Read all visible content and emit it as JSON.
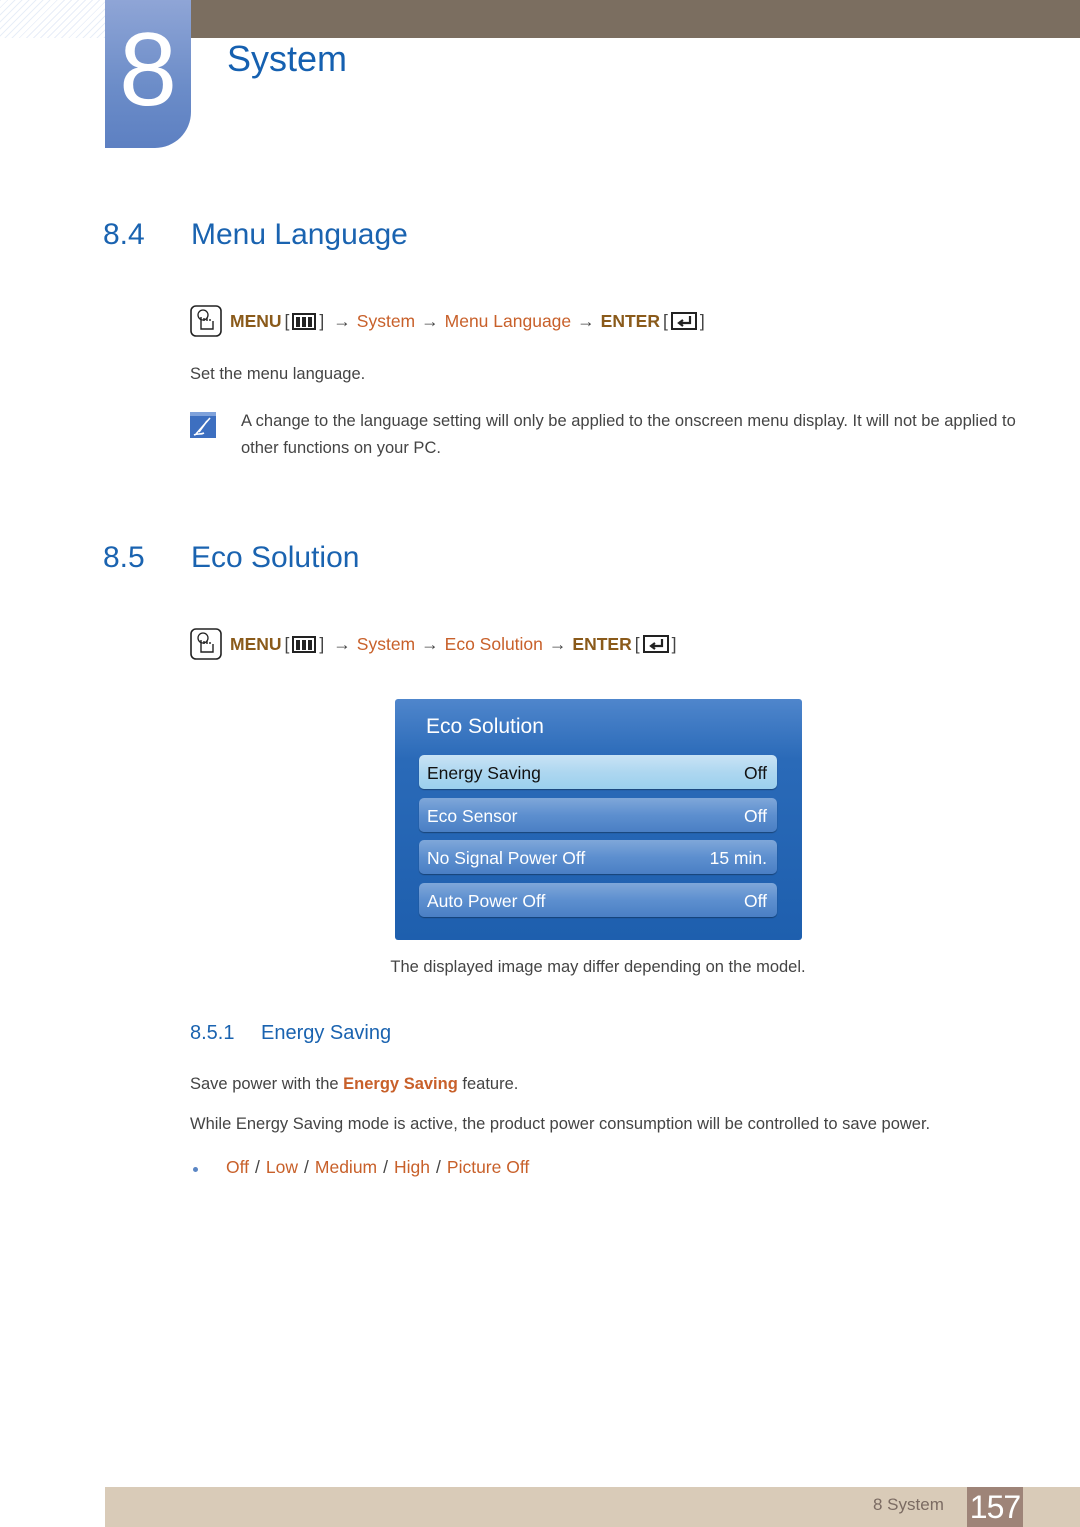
{
  "chapter": {
    "number": "8",
    "title": "System"
  },
  "sections": {
    "menu_language": {
      "number": "8.4",
      "title": "Menu Language",
      "path": {
        "menu": "MENU",
        "steps": [
          "System",
          "Menu Language"
        ],
        "enter": "ENTER",
        "arrow": "→",
        "open_bracket": "[",
        "close_bracket": "]"
      },
      "description": "Set the menu language.",
      "note": "A change to the language setting will only be applied to the onscreen menu display. It will not be applied to other functions on your PC."
    },
    "eco_solution": {
      "number": "8.5",
      "title": "Eco Solution",
      "path": {
        "menu": "MENU",
        "steps": [
          "System",
          "Eco Solution"
        ],
        "enter": "ENTER",
        "arrow": "→",
        "open_bracket": "[",
        "close_bracket": "]"
      },
      "osd": {
        "title": "Eco Solution",
        "items": [
          {
            "label": "Energy Saving",
            "value": "Off",
            "selected": true
          },
          {
            "label": "Eco Sensor",
            "value": "Off",
            "selected": false
          },
          {
            "label": "No Signal Power Off",
            "value": "15 min.",
            "selected": false
          },
          {
            "label": "Auto Power Off",
            "value": "Off",
            "selected": false
          }
        ]
      },
      "caption": "The displayed image may differ depending on the model."
    },
    "energy_saving": {
      "number": "8.5.1",
      "title": "Energy Saving",
      "intro_prefix": "Save power with the ",
      "intro_highlight": "Energy Saving",
      "intro_suffix": " feature.",
      "description": "While Energy Saving mode is active, the product power consumption will be controlled to save power.",
      "options": [
        "Off",
        "Low",
        "Medium",
        "High",
        "Picture Off"
      ],
      "option_separator": "/"
    }
  },
  "footer": {
    "chapter_label": "8 System",
    "page_number": "157"
  },
  "icons": {
    "hand": "hand-pointer-icon",
    "menu_key": "menu-button-icon",
    "enter_key": "enter-button-icon",
    "note": "note-pencil-icon"
  },
  "colors": {
    "heading_blue": "#1a63b0",
    "highlight_orange": "#c8602a",
    "menu_brown": "#8a5a1a",
    "top_bar": "#7b6e60",
    "footer_bar": "#d9cbb8",
    "page_box": "#9e8478"
  }
}
